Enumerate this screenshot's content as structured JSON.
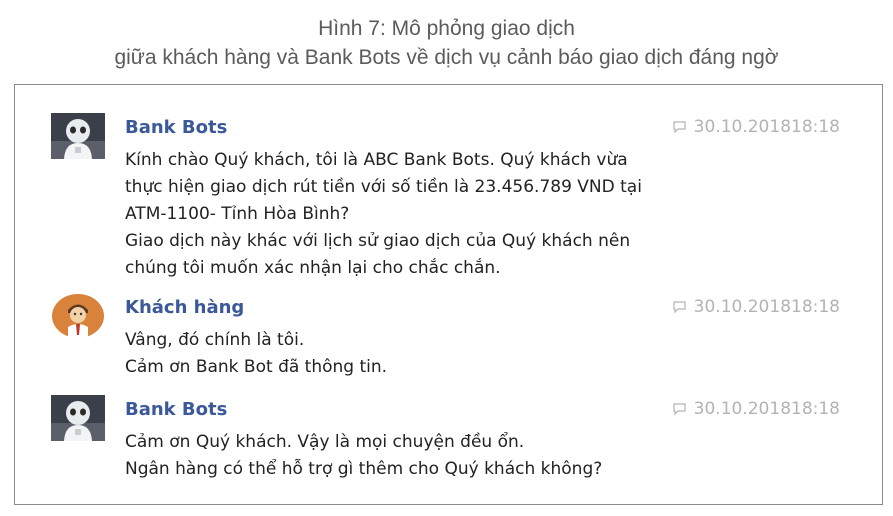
{
  "caption": {
    "line1": "Hình 7: Mô phỏng giao dịch",
    "line2": "giữa khách hàng và Bank Bots về dịch vụ cảnh báo giao dịch đáng ngờ"
  },
  "messages": [
    {
      "sender": "Bank Bots",
      "avatar_icon": "robot-avatar-icon",
      "timestamp": "30.10.201818:18",
      "lines": [
        "Kính chào Quý khách, tôi là ABC Bank Bots. Quý khách vừa",
        "thực hiện giao dịch rút tiền với số tiền là 23.456.789 VND tại",
        "ATM-1100- Tỉnh Hòa Bình?",
        "Giao dịch này khác với lịch sử giao dịch của Quý khách nên",
        "chúng tôi muốn xác nhận lại cho chắc chắn."
      ]
    },
    {
      "sender": "Khách hàng",
      "avatar_icon": "customer-avatar-icon",
      "timestamp": "30.10.201818:18",
      "lines": [
        "Vâng, đó chính là tôi.",
        "Cảm ơn Bank Bot đã thông tin."
      ]
    },
    {
      "sender": "Bank Bots",
      "avatar_icon": "robot-avatar-icon",
      "timestamp": "30.10.201818:18",
      "lines": [
        "Cảm ơn Quý khách. Vậy là mọi chuyện đều ổn.",
        "Ngân hàng có thể hỗ trợ gì thêm cho Quý khách không?"
      ]
    }
  ],
  "colors": {
    "sender": "#3b5998",
    "timestamp": "#b3b3b3",
    "caption": "#5b5b5b",
    "border": "#8a8a8a"
  }
}
